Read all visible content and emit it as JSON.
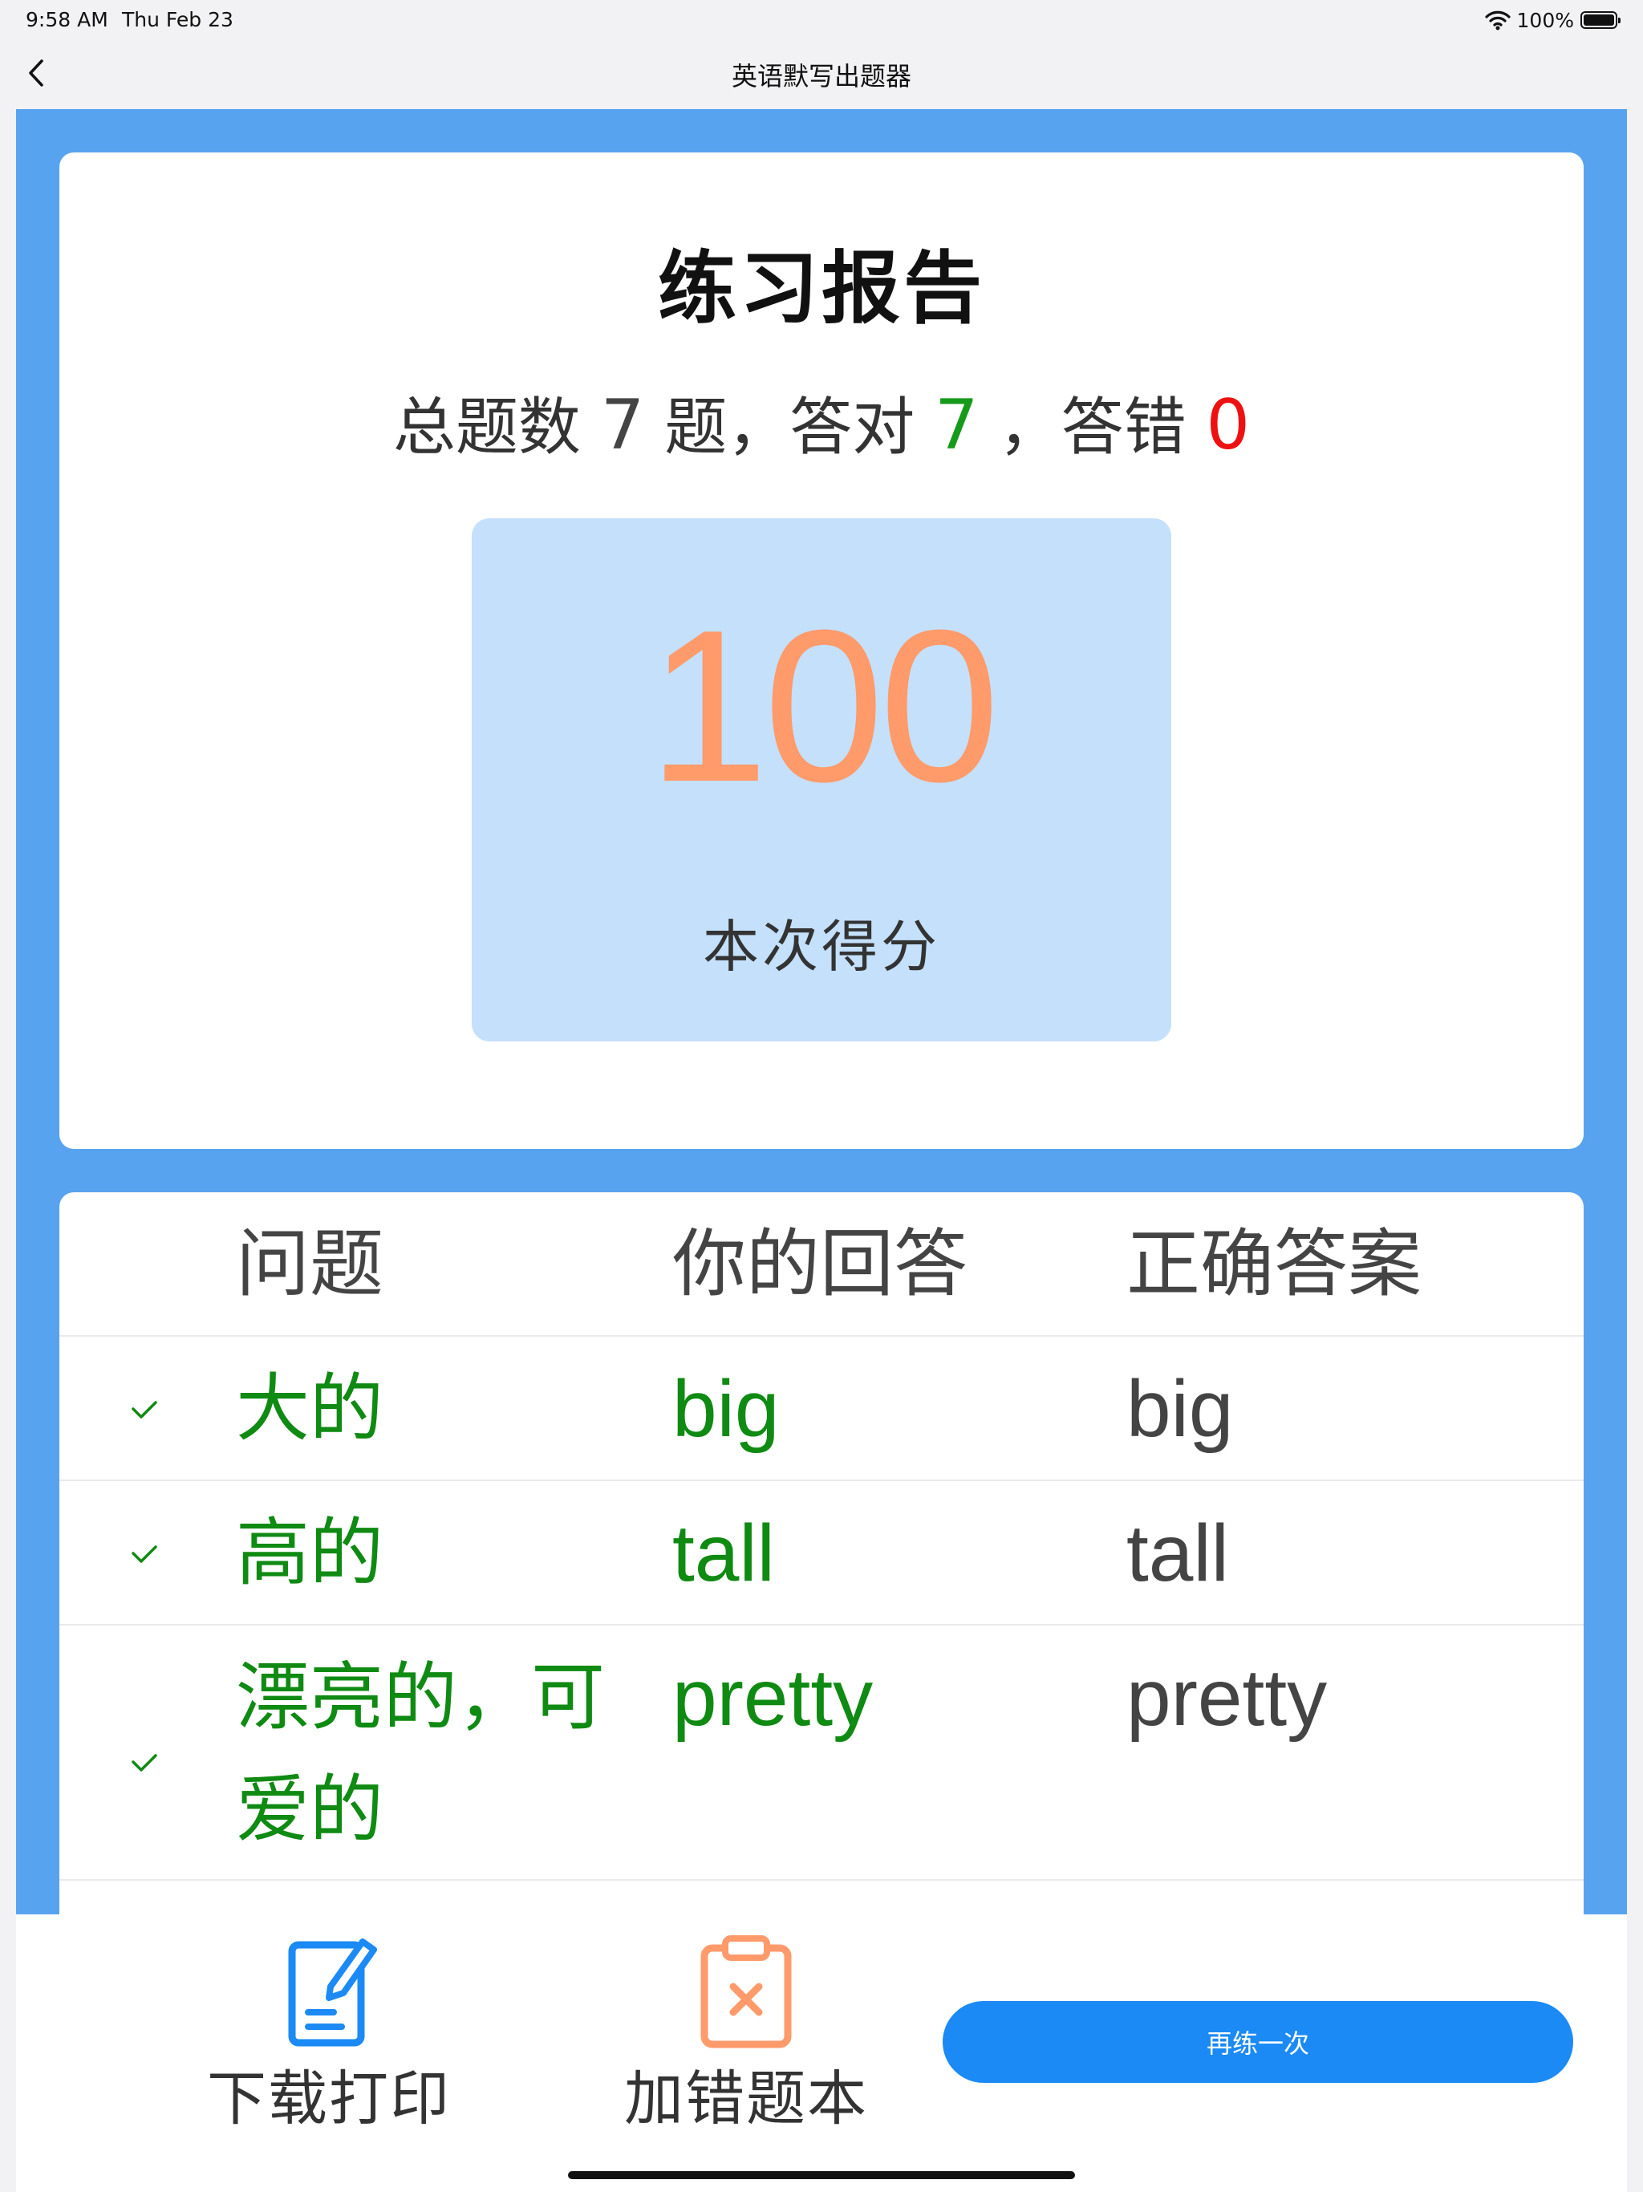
{
  "status_bar": {
    "time": "9:58 AM",
    "date": "Thu Feb 23",
    "battery": "100%"
  },
  "nav": {
    "title": "英语默写出题器"
  },
  "report": {
    "title": "练习报告",
    "summary": {
      "total_prefix": "总题数",
      "total": "7",
      "total_suffix": "题，答对",
      "correct": "7",
      "separator": "，答错",
      "wrong": "0"
    },
    "score": {
      "value": "100",
      "label": "本次得分"
    }
  },
  "table": {
    "headers": {
      "question": "问题",
      "answer": "你的回答",
      "correct": "正确答案"
    },
    "rows": [
      {
        "question": "大的",
        "answer": "big",
        "correct": "big",
        "status": "correct"
      },
      {
        "question": "高的",
        "answer": "tall",
        "correct": "tall",
        "status": "correct"
      },
      {
        "question": "漂亮的，可爱的",
        "answer": "pretty",
        "correct": "pretty",
        "status": "correct"
      }
    ]
  },
  "bottom": {
    "print_label": "下载打印",
    "mistake_label": "加错题本",
    "retry_label": "再练一次",
    "print_icon": "document-edit-icon",
    "mistake_icon": "clipboard-x-icon"
  },
  "colors": {
    "panel_blue": "#58a3f0",
    "score_orange": "#ff9a6a",
    "correct_green": "#169a1a",
    "wrong_red": "#ee1111",
    "button_blue": "#1b8af4"
  }
}
